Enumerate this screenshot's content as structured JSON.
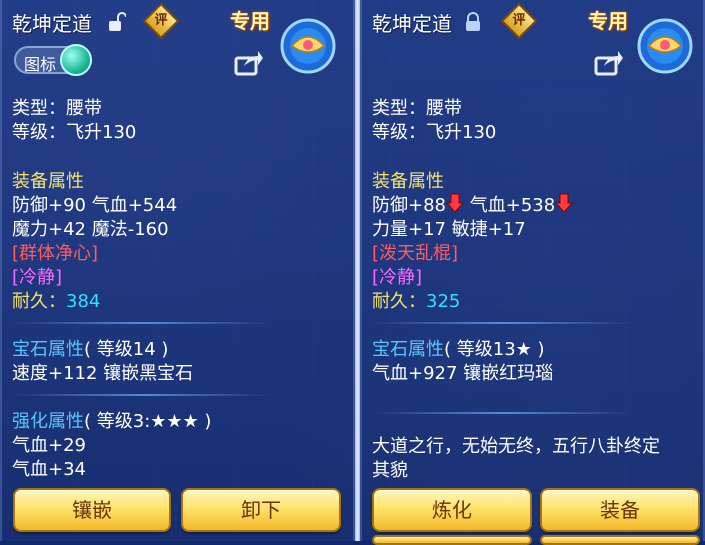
{
  "left": {
    "title": "乾坤定道",
    "ping_label": "评",
    "exclusive_label": "专用",
    "icon_toggle_label": "图标",
    "type_line": "类型：腰带",
    "level_line": "等级：飞升130",
    "equip_attr_header": "装备属性",
    "stats_line1": "防御+90 气血+544",
    "stats_line2": "魔力+42 魔法-160",
    "special_skill": "[群体净心]",
    "special_effect": "[冷静]",
    "durability_label": "耐久：",
    "durability_value": "384",
    "gem_header": "宝石属性",
    "gem_level": "( 等级14 )",
    "gem_effect": "速度+112 镶嵌黑宝石",
    "enhance_header": "强化属性",
    "enhance_level": "( 等级3:★★★ )",
    "enhance_line1": "气血+29",
    "enhance_line2": "气血+34",
    "buttons": {
      "inlay": "镶嵌",
      "unequip": "卸下"
    }
  },
  "right": {
    "title": "乾坤定道",
    "ping_label": "评",
    "exclusive_label": "专用",
    "type_line": "类型：腰带",
    "level_line": "等级：飞升130",
    "equip_attr_header": "装备属性",
    "stat_defense": "防御+88",
    "stat_hp": "气血+538",
    "stats_line2": "力量+17 敏捷+17",
    "special_skill": "[泼天乱棍]",
    "special_effect": "[冷静]",
    "durability_label": "耐久：",
    "durability_value": "325",
    "gem_header": "宝石属性",
    "gem_level": "( 等级13★ )",
    "gem_effect": "气血+927 镶嵌红玛瑙",
    "description_line1": "大道之行，无始无终，五行八卦终定",
    "description_line2": "其貌",
    "buttons": {
      "refine": "炼化",
      "equip": "装备"
    }
  },
  "colors": {
    "header_yellow": "#f3e36a",
    "skill_red": "#ff5b63",
    "effect_pink": "#ff66ff",
    "durability_cyan": "#2fe0ff",
    "gem_blue": "#57c6ff",
    "button_gold": "#ffe36b"
  }
}
